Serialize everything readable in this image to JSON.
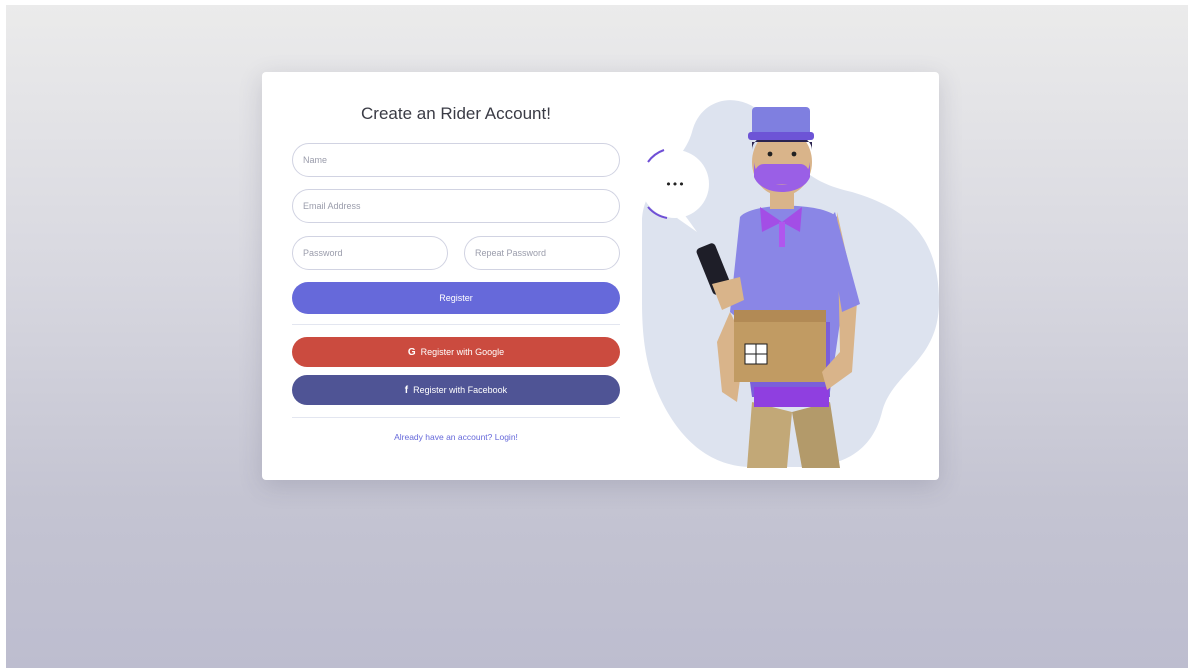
{
  "form": {
    "title": "Create an Rider Account!",
    "name_placeholder": "Name",
    "email_placeholder": "Email Address",
    "password_placeholder": "Password",
    "repeat_password_placeholder": "Repeat Password",
    "register_label": "Register",
    "google_label": "Register with Google",
    "facebook_label": "Register with Facebook",
    "login_link": "Already have an account? Login!"
  },
  "icons": {
    "google": "G",
    "facebook": "f",
    "speech_dots": "•••"
  },
  "colors": {
    "primary": "#6669da",
    "google": "#cb4b3f",
    "facebook": "#4f5495"
  }
}
